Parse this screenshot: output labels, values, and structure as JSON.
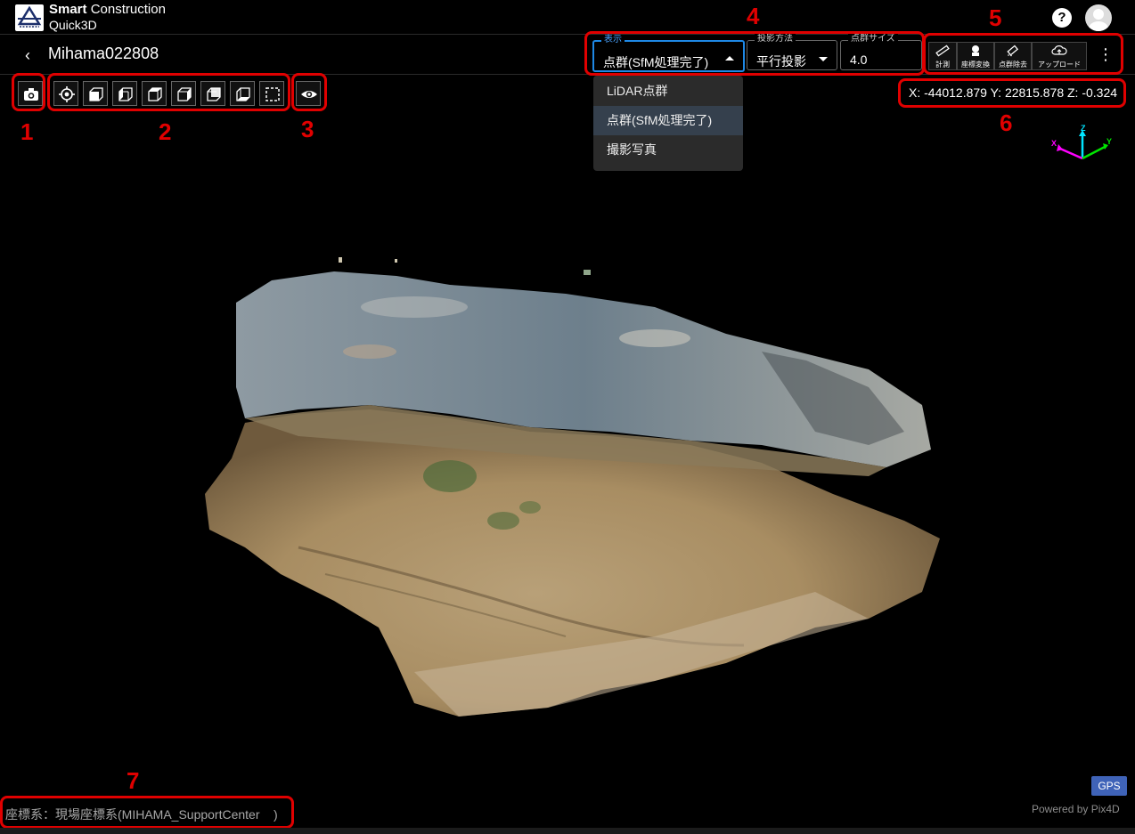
{
  "header": {
    "brand_bold": "Smart",
    "brand_rest": " Construction",
    "brand_line2": "Quick3D",
    "help_label": "?"
  },
  "subheader": {
    "back_label": "‹",
    "title": "Mihama022808"
  },
  "controls": {
    "display": {
      "legend": "表示",
      "value": "点群(SfM処理完了)"
    },
    "projection": {
      "legend": "投影方法",
      "value": "平行投影"
    },
    "point_size": {
      "legend": "点群サイズ",
      "value": "4.0"
    }
  },
  "right_tools": [
    {
      "label": "計測",
      "icon": "ruler-icon"
    },
    {
      "label": "座標変換",
      "icon": "coordinate-transform-icon"
    },
    {
      "label": "点群除去",
      "icon": "eraser-icon"
    },
    {
      "label": "アップロード",
      "icon": "cloud-upload-icon"
    }
  ],
  "more_label": "⋮",
  "dropdown": {
    "items": [
      "LiDAR点群",
      "点群(SfM処理完了)",
      "撮影写真"
    ],
    "selected": "点群(SfM処理完了)"
  },
  "coordinates": "X: -44012.879 Y: 22815.878 Z: -0.324",
  "axis_labels": {
    "x": "X",
    "y": "Y",
    "z": "Z"
  },
  "annotations": [
    "1",
    "2",
    "3",
    "4",
    "5",
    "6",
    "7"
  ],
  "footer": {
    "gps": "GPS",
    "powered": "Powered by Pix4D",
    "crs": "座標系：現場座標系(MIHAMA_SupportCenter    )"
  },
  "colors": {
    "accent": "#1e88e5",
    "annotation": "#e00000",
    "gps": "#3f63b8"
  }
}
